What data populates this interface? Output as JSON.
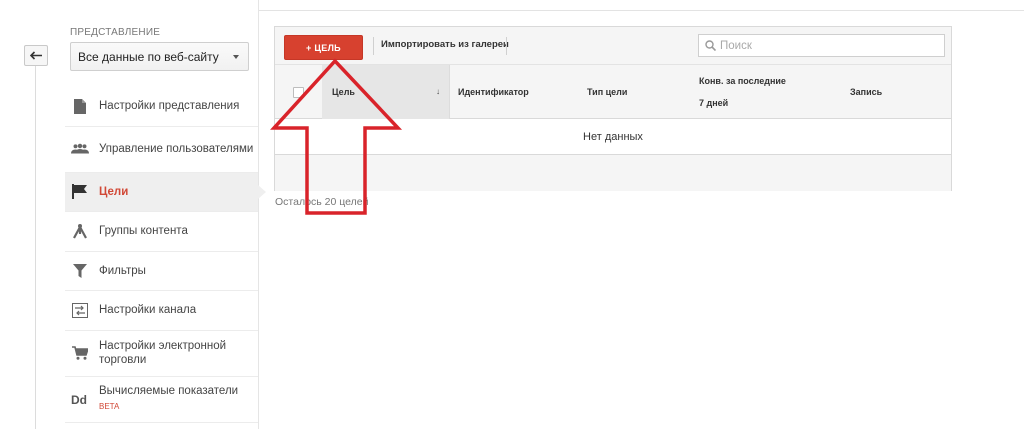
{
  "sidebar": {
    "section_heading": "ПРЕДСТАВЛЕНИЕ",
    "view_select_value": "Все данные по веб-сайту",
    "items": [
      {
        "label": "Настройки представления",
        "icon": "document-icon"
      },
      {
        "label": "Управление пользователями",
        "icon": "users-icon"
      },
      {
        "label": "Цели",
        "icon": "flag-icon",
        "active": true
      },
      {
        "label": "Группы контента",
        "icon": "content-group-icon"
      },
      {
        "label": "Фильтры",
        "icon": "filter-icon"
      },
      {
        "label": "Настройки канала",
        "icon": "channel-settings-icon"
      },
      {
        "label": "Настройки электронной торговли",
        "icon": "cart-icon"
      },
      {
        "label": "Вычисляемые показатели",
        "badge": "BETA",
        "icon": "calculated-metrics-icon"
      }
    ]
  },
  "toolbar": {
    "add_goal_label": "+ ЦЕЛЬ",
    "import_label": "Импортировать из галереи",
    "search_placeholder": "Поиск"
  },
  "table": {
    "columns": [
      "Цель",
      "Идентификатор",
      "Тип цели",
      "Конв. за последние",
      "7 дней",
      "Запись"
    ],
    "empty_text": "Нет данных"
  },
  "remaining_text": "Осталось 20 целей",
  "colors": {
    "accent": "#d14836",
    "add_button": "#d7412f",
    "annotation_arrow": "#d9232a"
  }
}
